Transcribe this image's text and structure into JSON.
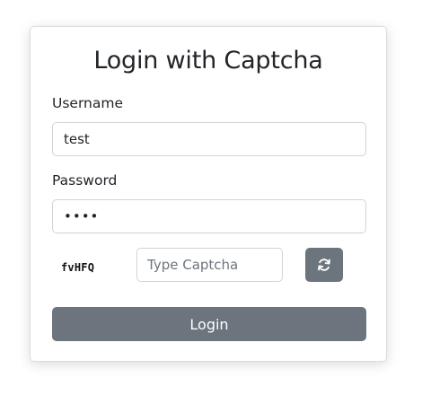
{
  "form": {
    "title": "Login with Captcha",
    "username_label": "Username",
    "username_value": "test",
    "password_label": "Password",
    "password_value": "test",
    "captcha_text": "fvHFQ",
    "captcha_placeholder": "Type Captcha",
    "refresh_icon": "refresh-icon",
    "login_label": "Login"
  },
  "colors": {
    "button_bg": "#6c757d",
    "button_text": "#ffffff",
    "input_border": "#ced4da",
    "card_border": "#dcdcdc"
  }
}
